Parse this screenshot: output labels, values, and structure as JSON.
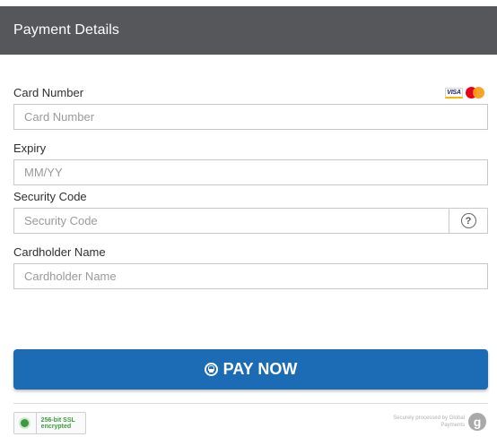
{
  "header": {
    "title": "Payment Details"
  },
  "card_number": {
    "label": "Card Number",
    "placeholder": "Card Number",
    "value": ""
  },
  "card_logos": {
    "visa": "VISA"
  },
  "expiry": {
    "label": "Expiry",
    "placeholder": "MM/YY",
    "value": ""
  },
  "security_code": {
    "label": "Security Code",
    "placeholder": "Security Code",
    "value": "",
    "help": "?"
  },
  "cardholder_name": {
    "label": "Cardholder Name",
    "placeholder": "Cardholder Name",
    "value": ""
  },
  "pay_button": {
    "label": "PAY NOW"
  },
  "footer": {
    "ssl_text": "256-bit SSL encrypted",
    "processed_text": "Securely processed by Global Payments",
    "gp_logo": "g"
  },
  "colors": {
    "header_bg": "#55575b",
    "pay_button_bg": "#1b6bb5",
    "ssl_green": "#3c9a3c"
  }
}
